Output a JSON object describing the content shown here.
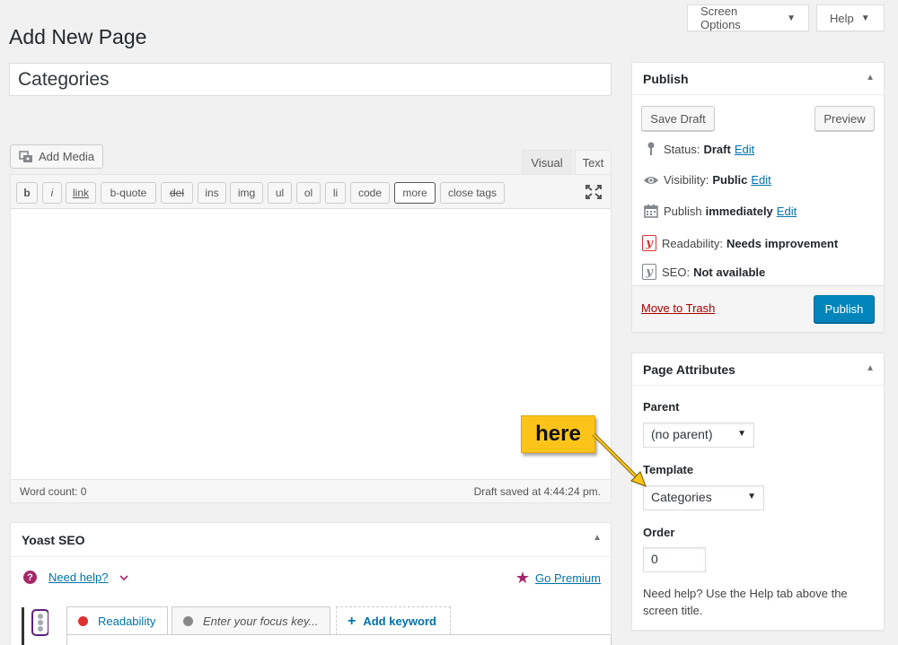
{
  "header": {
    "page_title": "Add New Page",
    "screen_options": "Screen Options",
    "help": "Help"
  },
  "post": {
    "title_value": "Categories"
  },
  "editor": {
    "add_media": "Add Media",
    "tab_visual": "Visual",
    "tab_text": "Text",
    "quicktags": [
      "b",
      "i",
      "link",
      "b-quote",
      "del",
      "ins",
      "img",
      "ul",
      "ol",
      "li",
      "code",
      "more",
      "close tags"
    ],
    "word_count": "Word count: 0",
    "draft_saved": "Draft saved at 4:44:24 pm."
  },
  "publish": {
    "title": "Publish",
    "save_draft": "Save Draft",
    "preview": "Preview",
    "status_label": "Status:",
    "status_value": "Draft",
    "visibility_label": "Visibility:",
    "visibility_value": "Public",
    "publish_label": "Publish",
    "publish_value": "immediately",
    "edit": "Edit",
    "readability_label": "Readability:",
    "readability_value": "Needs improvement",
    "seo_label": "SEO:",
    "seo_value": "Not available",
    "move_to_trash": "Move to Trash",
    "publish_button": "Publish"
  },
  "page_attributes": {
    "title": "Page Attributes",
    "parent_label": "Parent",
    "parent_value": "(no parent)",
    "template_label": "Template",
    "template_value": "Categories",
    "order_label": "Order",
    "order_value": "0",
    "help_text": "Need help? Use the Help tab above the screen title."
  },
  "callout": {
    "text": "here"
  },
  "yoast": {
    "title": "Yoast SEO",
    "need_help": "Need help?",
    "go_premium": "Go Premium",
    "tab_readability": "Readability",
    "focus_placeholder": "Enter your focus key...",
    "add_keyword": "Add keyword"
  },
  "colors": {
    "primary": "#0085ba",
    "link": "#0073aa",
    "trash": "#a00",
    "yoast": "#a4286a",
    "callout": "#fcc419"
  }
}
